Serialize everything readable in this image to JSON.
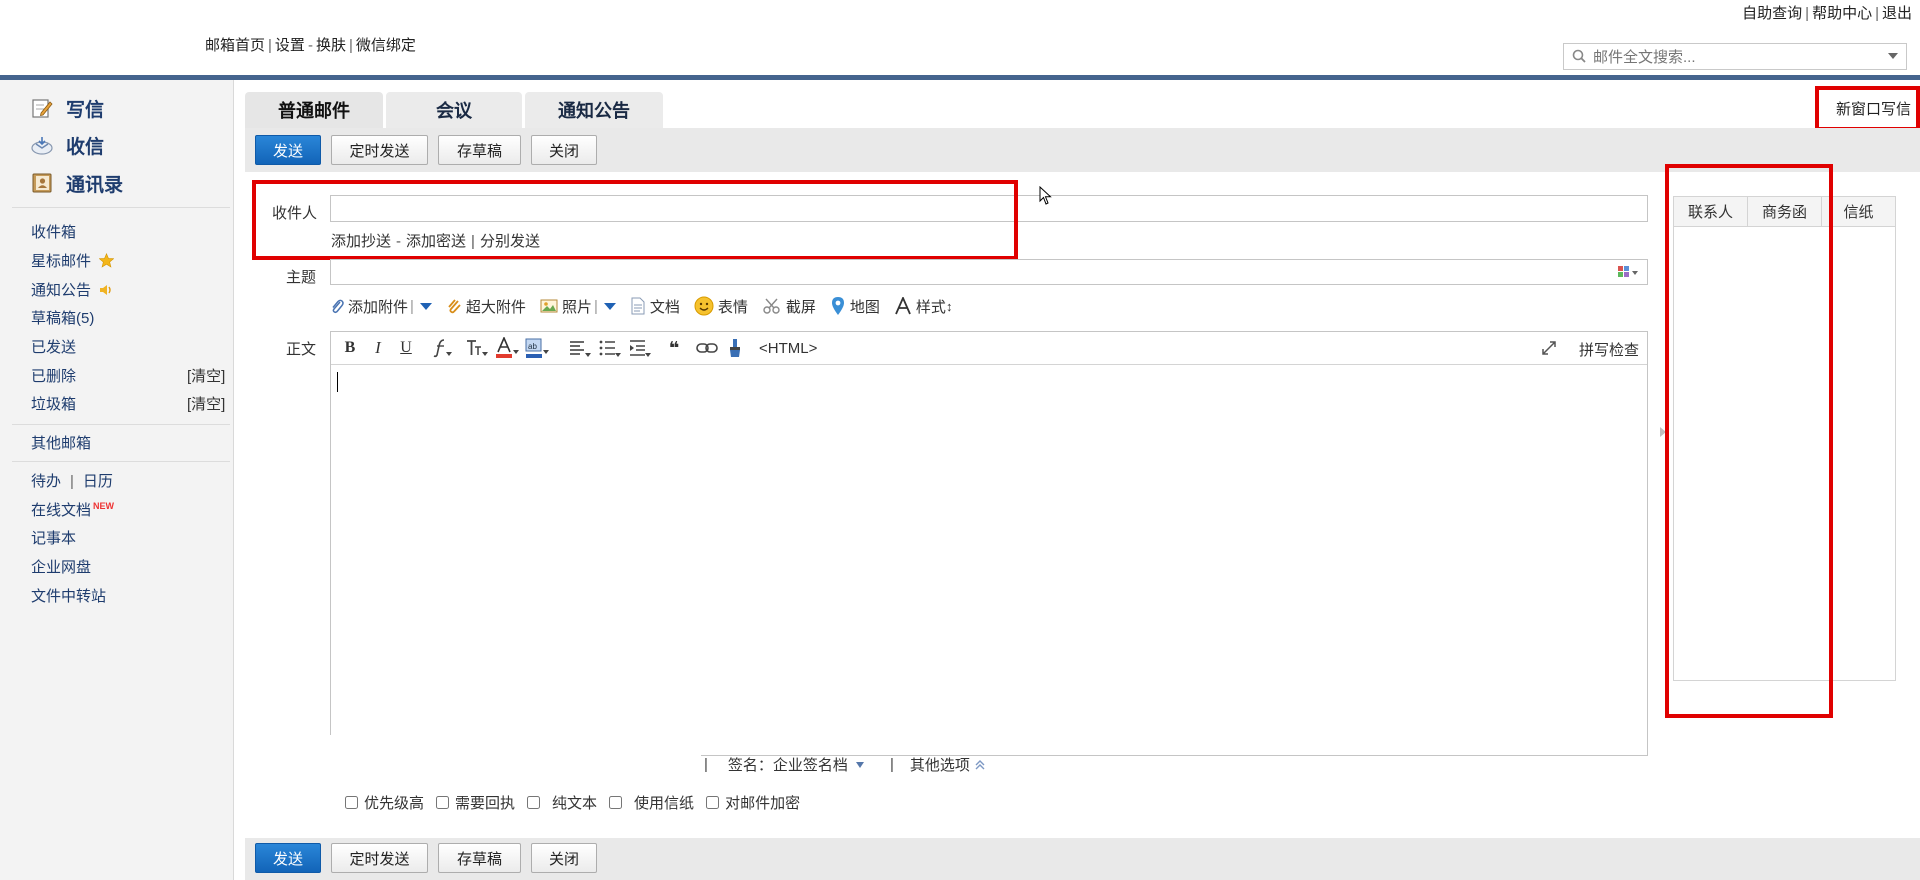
{
  "header": {
    "top_links": [
      "自助查询",
      "帮助中心",
      "退出"
    ],
    "nav": {
      "home": "邮箱首页",
      "settings": "设置",
      "skin": "换肤",
      "wechat": "微信绑定"
    },
    "search_placeholder": "邮件全文搜索..."
  },
  "sidebar": {
    "primary": [
      {
        "label": "写信",
        "icon": "compose-icon"
      },
      {
        "label": "收信",
        "icon": "inbox-receive-icon"
      },
      {
        "label": "通讯录",
        "icon": "contacts-book-icon"
      }
    ],
    "folders": [
      {
        "label": "收件箱"
      },
      {
        "label": "星标邮件",
        "icon": "star-icon"
      },
      {
        "label": "通知公告",
        "icon": "speaker-icon"
      },
      {
        "label": "草稿箱(5)"
      },
      {
        "label": "已发送"
      },
      {
        "label": "已删除",
        "action": "[清空]"
      },
      {
        "label": "垃圾箱",
        "action": "[清空]"
      }
    ],
    "other_mailbox": "其他邮箱",
    "tools": {
      "todo": "待办",
      "calendar": "日历",
      "online_docs": "在线文档",
      "new_badge": "NEW",
      "notes": "记事本",
      "netdisk": "企业网盘",
      "transfer": "文件中转站"
    }
  },
  "tabs": [
    "普通邮件",
    "会议",
    "通知公告"
  ],
  "toolbar": {
    "send": "发送",
    "schedule": "定时发送",
    "draft": "存草稿",
    "close": "关闭"
  },
  "new_window": "新窗口写信",
  "compose": {
    "to_label": "收件人",
    "to_value": "",
    "add_cc": "添加抄送",
    "add_bcc": "添加密送",
    "separate_send": "分别发送",
    "subject_label": "主题",
    "subject_value": "",
    "body_label": "正文",
    "attachments": {
      "add_attachment": "添加附件",
      "large_attachment": "超大附件",
      "photo": "照片",
      "document": "文档",
      "emoji": "表情",
      "screenshot": "截屏",
      "map": "地图",
      "style": "样式"
    },
    "editor": {
      "html": "<HTML>",
      "spell_check": "拼写检查"
    },
    "signature_label": "签名：",
    "signature_value": "企业签名档",
    "other_options": "其他选项",
    "options": [
      "优先级高",
      "需要回执",
      "纯文本",
      "使用信纸",
      "对邮件加密"
    ]
  },
  "right_panel": {
    "tabs": [
      "联系人",
      "商务函",
      "信纸"
    ]
  },
  "colors": {
    "brand_blue": "#45648e",
    "primary_button": "#1a73c9",
    "highlight_red": "#e00000"
  }
}
